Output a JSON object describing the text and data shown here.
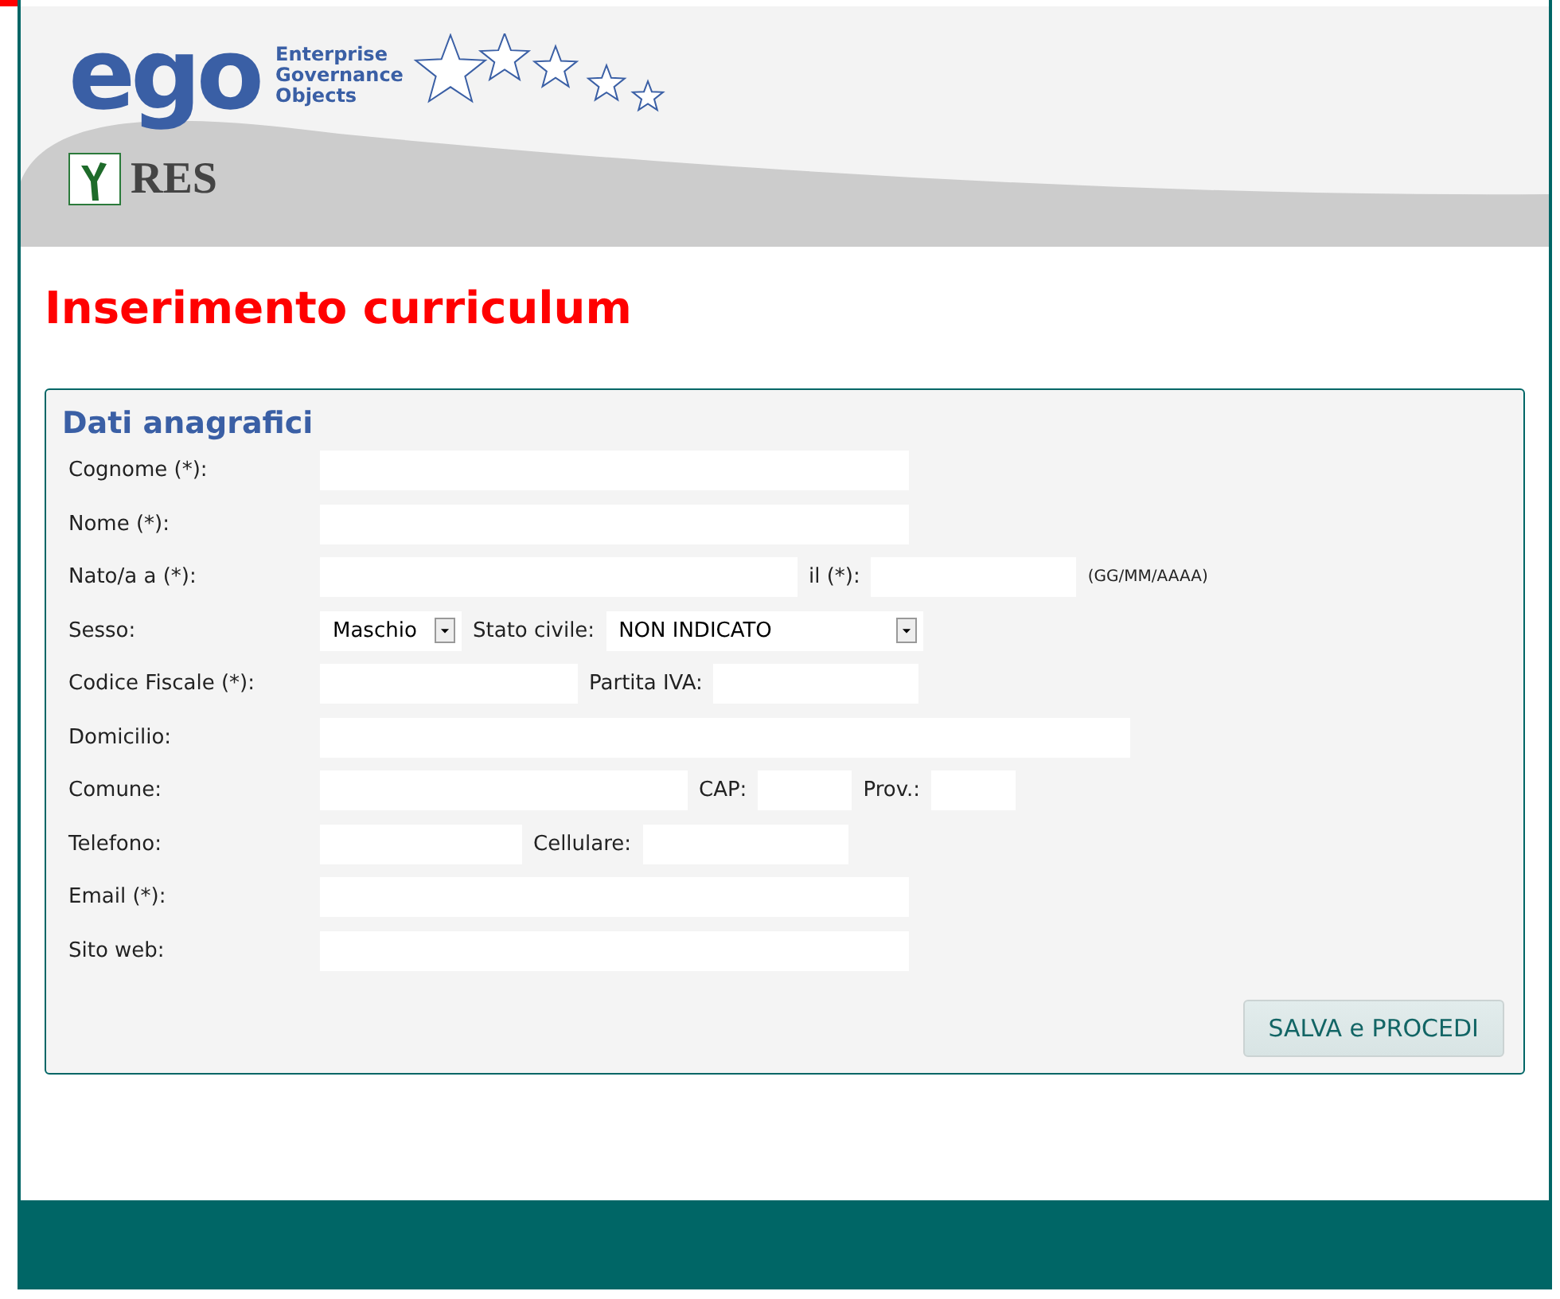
{
  "header": {
    "logo_word": "ego",
    "logo_tagline": [
      "Enterprise",
      "Governance",
      "Objects"
    ],
    "partner": "RES"
  },
  "title": "Inserimento curriculum",
  "form": {
    "legend": "Dati anagrafici",
    "rows": [
      {
        "label": "Cognome (*):",
        "fields": [
          {
            "kind": "text"
          }
        ]
      },
      {
        "label": "Nome (*):",
        "fields": [
          {
            "kind": "text"
          }
        ]
      },
      {
        "label": "Nato/a a (*):",
        "fields": [
          {
            "kind": "text"
          },
          {
            "kind": "label",
            "text": "il (*):"
          },
          {
            "kind": "text"
          },
          {
            "kind": "hint",
            "text": "(GG/MM/AAAA)"
          }
        ]
      },
      {
        "label": "Sesso:",
        "fields": [
          {
            "kind": "select",
            "value": "Maschio"
          },
          {
            "kind": "label",
            "text": "Stato civile:"
          },
          {
            "kind": "select",
            "value": "NON INDICATO"
          }
        ]
      },
      {
        "label": "Codice Fiscale (*):",
        "fields": [
          {
            "kind": "text"
          },
          {
            "kind": "label",
            "text": "Partita IVA:"
          },
          {
            "kind": "text"
          }
        ]
      },
      {
        "label": "Domicilio:",
        "fields": [
          {
            "kind": "text"
          }
        ]
      },
      {
        "label": "Comune:",
        "fields": [
          {
            "kind": "text"
          },
          {
            "kind": "label",
            "text": "CAP:"
          },
          {
            "kind": "text"
          },
          {
            "kind": "label",
            "text": "Prov.:"
          },
          {
            "kind": "text"
          }
        ]
      },
      {
        "label": "Telefono:",
        "fields": [
          {
            "kind": "text"
          },
          {
            "kind": "label",
            "text": "Cellulare:"
          },
          {
            "kind": "text"
          }
        ]
      },
      {
        "label": "Email (*):",
        "fields": [
          {
            "kind": "text"
          }
        ]
      },
      {
        "label": "Sito web:",
        "fields": [
          {
            "kind": "text"
          }
        ]
      }
    ],
    "submit": "SALVA e PROCEDI"
  }
}
